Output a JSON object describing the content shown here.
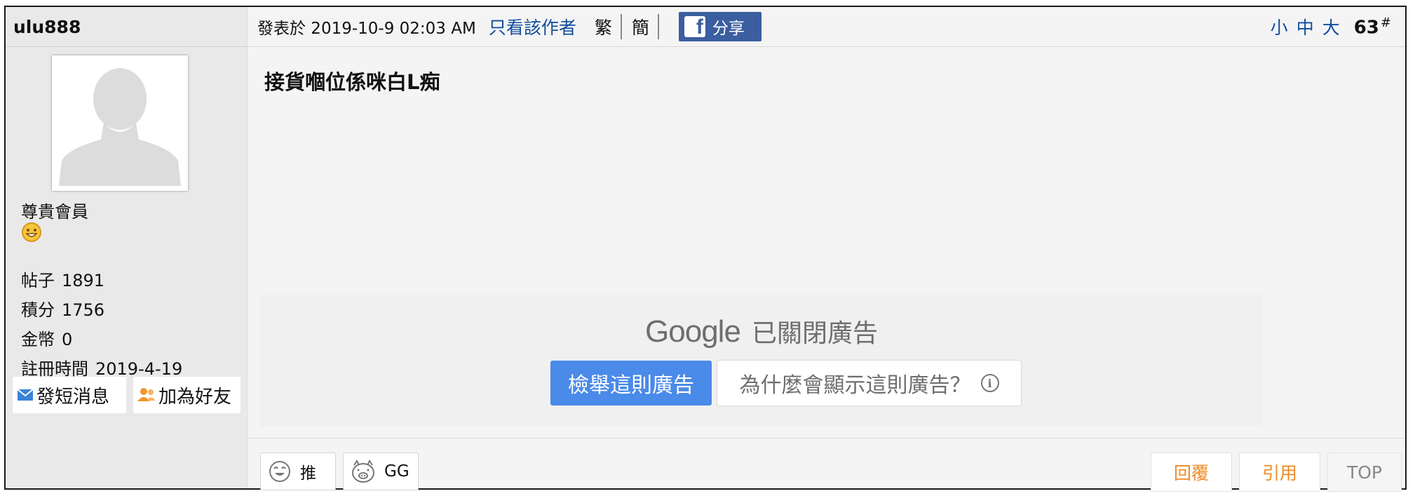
{
  "sidebar": {
    "username": "ulu888",
    "rank": "尊貴會員",
    "stats": [
      {
        "label": "帖子",
        "value": "1891"
      },
      {
        "label": "積分",
        "value": "1756"
      },
      {
        "label": "金幣",
        "value": "0"
      },
      {
        "label": "註冊時間",
        "value": "2019-4-19"
      }
    ],
    "send_message": "發短消息",
    "add_friend": "加為好友"
  },
  "header": {
    "posted": "發表於 2019-10-9 02:03 AM",
    "author_only": "只看該作者",
    "traditional": "繁",
    "simplified": "簡",
    "share": "分享",
    "font_small": "小",
    "font_medium": "中",
    "font_large": "大",
    "floor": "63",
    "floor_suffix": "#"
  },
  "post": {
    "content": "接貨嗰位係咪白L痴"
  },
  "ad": {
    "brand": "Google",
    "closed_text": "已關閉廣告",
    "report": "檢舉這則廣告",
    "why": "為什麼會顯示這則廣告？"
  },
  "footer": {
    "push": "推",
    "gg": "GG",
    "reply": "回覆",
    "quote": "引用",
    "top": "TOP"
  },
  "colors": {
    "link_blue": "#114c9c",
    "facebook": "#3b5ea0",
    "ad_blue": "#4a8ae8",
    "action_orange": "#f08a24"
  }
}
